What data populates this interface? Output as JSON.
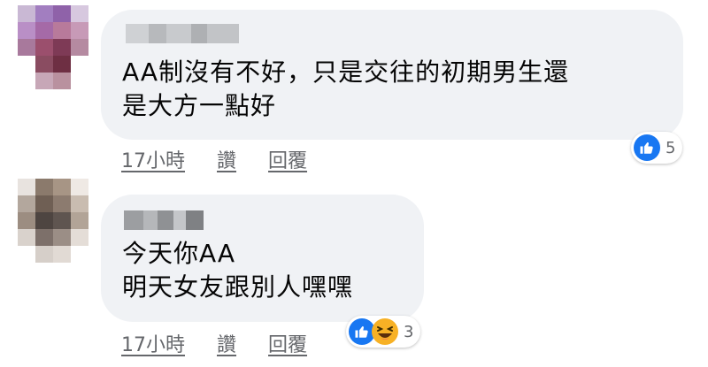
{
  "comments": [
    {
      "text": "AA制沒有不好，只是交往的初期男生還\n是大方一點好",
      "time": "17小時",
      "like_label": "讚",
      "reply_label": "回覆",
      "reactions": [
        "like"
      ],
      "reaction_count": "5"
    },
    {
      "text": "今天你AA\n明天女友跟別人嘿嘿",
      "time": "17小時",
      "like_label": "讚",
      "reply_label": "回覆",
      "reactions": [
        "like",
        "haha"
      ],
      "reaction_count": "3"
    }
  ],
  "colors": {
    "bubble": "#f0f2f5",
    "like_blue": "#1877f2",
    "haha_yellow": "#f7b125",
    "meta_gray": "#65676b"
  }
}
